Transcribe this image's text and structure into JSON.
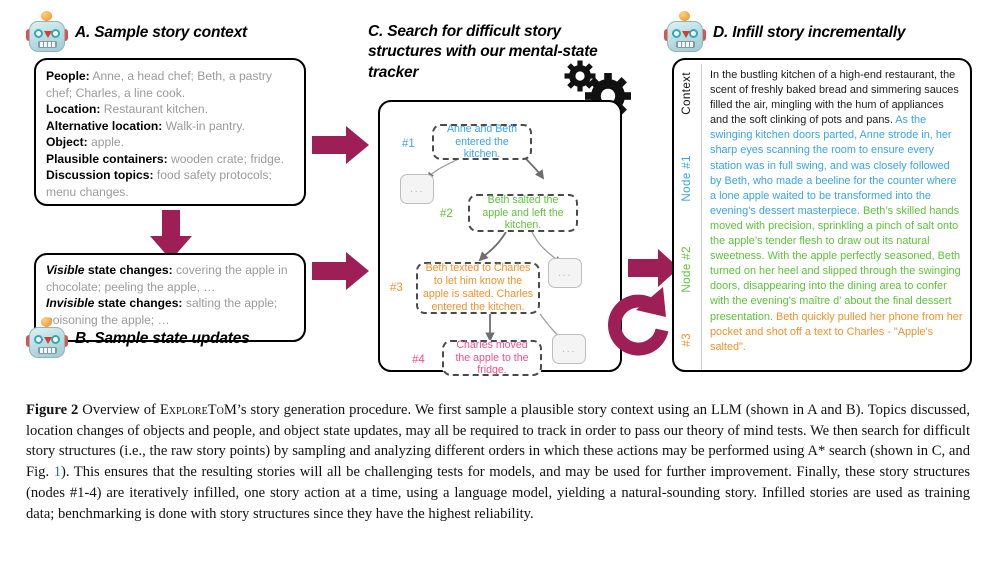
{
  "figure": {
    "label": "Figure 2",
    "caption_part1": " Overview of ",
    "caption_smallcaps": "ExploreToM",
    "caption_part2": "’s story generation procedure. We first sample a plausible story context using an LLM (shown in A and B). Topics discussed, location changes of objects and people, and object state updates, may all be required to track in order to pass our theory of mind tests. We then search for difficult story structures (i.e., the raw story points) by sampling and analyzing different orders in which these actions may be performed using A* search (shown in C, and Fig. ",
    "caption_link": "1",
    "caption_part3": "). This ensures that the resulting stories will all be challenging tests for models, and may be used for further improvement. Finally, these story structures (nodes #1-4) are iteratively infilled, one story action at a time, using a language model, yielding a natural-sounding story. Infilled stories are used as training data; benchmarking is done with story structures since they have the highest reliability."
  },
  "panelA": {
    "title": "A. Sample story context",
    "rows": [
      {
        "key": "People:",
        "value": " Anne, a head chef; Beth, a pastry chef; Charles, a line cook."
      },
      {
        "key": "Location:",
        "value": " Restaurant kitchen."
      },
      {
        "key": "Alternative location:",
        "value": " Walk-in pantry."
      },
      {
        "key": "Object:",
        "value": " apple."
      },
      {
        "key": "Plausible containers:",
        "value": " wooden crate; fridge."
      },
      {
        "key": "Discussion topics:",
        "value": " food safety protocols; menu changes."
      }
    ]
  },
  "panelB": {
    "title": "B. Sample state updates",
    "rows": [
      {
        "key_em": "Visible",
        "key_rest": " state changes:",
        "value": " covering the apple in chocolate; peeling the apple, …"
      },
      {
        "key_em": "Invisible",
        "key_rest": " state changes:",
        "value": " salting the apple; poisoning the apple; …"
      }
    ]
  },
  "panelC": {
    "title": "C. Search for difficult story structures with our mental-state tracker",
    "nodes": [
      {
        "id": "#1",
        "text": "Anne and Beth entered the kitchen.",
        "color": "#3aa3e8"
      },
      {
        "id": "#2",
        "text": "Beth salted the apple and left the kitchen.",
        "color": "#5ec23b"
      },
      {
        "id": "#3",
        "text": "Beth texted to Charles to let him know the apple is salted. Charles entered the kitchen.",
        "color": "#f0922b"
      },
      {
        "id": "#4",
        "text": "Charles moved the apple to the fridge.",
        "color": "#f0508e"
      }
    ],
    "placeholder_label": "..."
  },
  "panelD": {
    "title": "D. Infill story incrementally",
    "margin_labels": [
      {
        "text": "Context",
        "color": "#111111"
      },
      {
        "text": "Node #1",
        "color": "#3aa3e8"
      },
      {
        "text": "Node #2",
        "color": "#5ec23b"
      },
      {
        "text": "#3",
        "color": "#f0922b"
      }
    ],
    "segments": [
      {
        "color": "#1b1b1b",
        "text": "In the bustling kitchen of a high-end restaurant, the scent of freshly baked bread and simmering sauces filled the air, mingling with the hum of appliances and the soft clinking of pots and pans. "
      },
      {
        "color": "#3aa3e8",
        "text": "As the swinging kitchen doors parted, Anne strode in, her sharp eyes scanning the room to ensure every station was in full swing, and was closely followed by Beth, who made a beeline for the counter where a lone apple waited to be transformed into the evening’s dessert masterpiece. "
      },
      {
        "color": "#5ec23b",
        "text": "Beth’s skilled hands moved with precision, sprinkling a pinch of salt onto the apple’s tender flesh to draw out its natural sweetness. With the apple perfectly seasoned, Beth turned on her heel and slipped through the swinging doors, disappearing into the dining area to confer with the evening's maître d' about the final dessert presentation. "
      },
      {
        "color": "#f0922b",
        "text": "Beth quickly pulled her phone from her pocket and shot off a text to Charles - \"Apple's salted\"."
      }
    ]
  },
  "colors": {
    "arrow": "#9e1f55",
    "graph_edge": "#6e6e6e",
    "panel_border": "#000000"
  }
}
